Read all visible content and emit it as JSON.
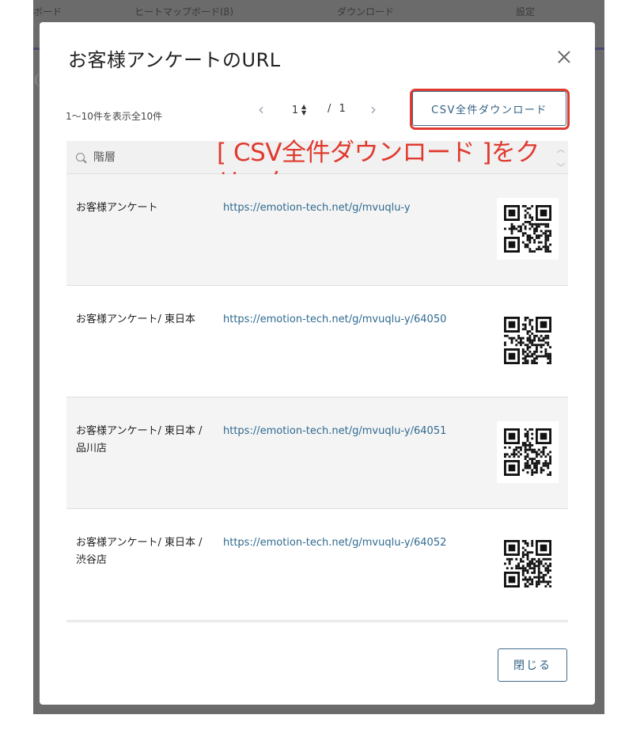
{
  "background": {
    "topbar_items": [
      "ボード",
      "ヒートマップボード(β)",
      "ダウンロード",
      "設定"
    ]
  },
  "modal": {
    "title": "お客様アンケートのURL",
    "close_icon": "close-icon",
    "count_text": "1〜10件を表示全10件",
    "pager": {
      "prev_icon": "chevron-left-icon",
      "next_icon": "chevron-right-icon",
      "current_page": "1",
      "total_text": "/ 1"
    },
    "csv_button_label": "CSV全件ダウンロード",
    "search": {
      "placeholder": "階層"
    },
    "annotation": "[ CSV全件ダウンロード ]をクリック",
    "rows": [
      {
        "label": "お客様アンケート",
        "url": "https://emotion-tech.net/g/mvuqlu-y"
      },
      {
        "label": "お客様アンケート/ 東日本",
        "url": "https://emotion-tech.net/g/mvuqlu-y/64050"
      },
      {
        "label": "お客様アンケート/ 東日本 / 品川店",
        "url": "https://emotion-tech.net/g/mvuqlu-y/64051"
      },
      {
        "label": "お客様アンケート/ 東日本 / 渋谷店",
        "url": "https://emotion-tech.net/g/mvuqlu-y/64052"
      }
    ],
    "close_button_label": "閉じる"
  },
  "colors": {
    "accent": "#2f5f82",
    "highlight": "#e03a2f",
    "link": "#2f6a90"
  }
}
